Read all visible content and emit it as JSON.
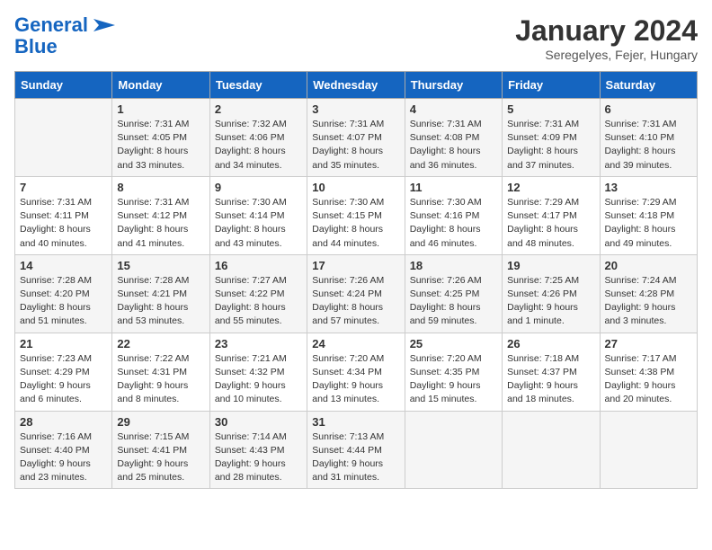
{
  "logo": {
    "line1": "General",
    "line2": "Blue"
  },
  "title": "January 2024",
  "subtitle": "Seregelyes, Fejer, Hungary",
  "days_of_week": [
    "Sunday",
    "Monday",
    "Tuesday",
    "Wednesday",
    "Thursday",
    "Friday",
    "Saturday"
  ],
  "weeks": [
    [
      {
        "day": "",
        "sunrise": "",
        "sunset": "",
        "daylight": ""
      },
      {
        "day": "1",
        "sunrise": "Sunrise: 7:31 AM",
        "sunset": "Sunset: 4:05 PM",
        "daylight": "Daylight: 8 hours and 33 minutes."
      },
      {
        "day": "2",
        "sunrise": "Sunrise: 7:32 AM",
        "sunset": "Sunset: 4:06 PM",
        "daylight": "Daylight: 8 hours and 34 minutes."
      },
      {
        "day": "3",
        "sunrise": "Sunrise: 7:31 AM",
        "sunset": "Sunset: 4:07 PM",
        "daylight": "Daylight: 8 hours and 35 minutes."
      },
      {
        "day": "4",
        "sunrise": "Sunrise: 7:31 AM",
        "sunset": "Sunset: 4:08 PM",
        "daylight": "Daylight: 8 hours and 36 minutes."
      },
      {
        "day": "5",
        "sunrise": "Sunrise: 7:31 AM",
        "sunset": "Sunset: 4:09 PM",
        "daylight": "Daylight: 8 hours and 37 minutes."
      },
      {
        "day": "6",
        "sunrise": "Sunrise: 7:31 AM",
        "sunset": "Sunset: 4:10 PM",
        "daylight": "Daylight: 8 hours and 39 minutes."
      }
    ],
    [
      {
        "day": "7",
        "sunrise": "Sunrise: 7:31 AM",
        "sunset": "Sunset: 4:11 PM",
        "daylight": "Daylight: 8 hours and 40 minutes."
      },
      {
        "day": "8",
        "sunrise": "Sunrise: 7:31 AM",
        "sunset": "Sunset: 4:12 PM",
        "daylight": "Daylight: 8 hours and 41 minutes."
      },
      {
        "day": "9",
        "sunrise": "Sunrise: 7:30 AM",
        "sunset": "Sunset: 4:14 PM",
        "daylight": "Daylight: 8 hours and 43 minutes."
      },
      {
        "day": "10",
        "sunrise": "Sunrise: 7:30 AM",
        "sunset": "Sunset: 4:15 PM",
        "daylight": "Daylight: 8 hours and 44 minutes."
      },
      {
        "day": "11",
        "sunrise": "Sunrise: 7:30 AM",
        "sunset": "Sunset: 4:16 PM",
        "daylight": "Daylight: 8 hours and 46 minutes."
      },
      {
        "day": "12",
        "sunrise": "Sunrise: 7:29 AM",
        "sunset": "Sunset: 4:17 PM",
        "daylight": "Daylight: 8 hours and 48 minutes."
      },
      {
        "day": "13",
        "sunrise": "Sunrise: 7:29 AM",
        "sunset": "Sunset: 4:18 PM",
        "daylight": "Daylight: 8 hours and 49 minutes."
      }
    ],
    [
      {
        "day": "14",
        "sunrise": "Sunrise: 7:28 AM",
        "sunset": "Sunset: 4:20 PM",
        "daylight": "Daylight: 8 hours and 51 minutes."
      },
      {
        "day": "15",
        "sunrise": "Sunrise: 7:28 AM",
        "sunset": "Sunset: 4:21 PM",
        "daylight": "Daylight: 8 hours and 53 minutes."
      },
      {
        "day": "16",
        "sunrise": "Sunrise: 7:27 AM",
        "sunset": "Sunset: 4:22 PM",
        "daylight": "Daylight: 8 hours and 55 minutes."
      },
      {
        "day": "17",
        "sunrise": "Sunrise: 7:26 AM",
        "sunset": "Sunset: 4:24 PM",
        "daylight": "Daylight: 8 hours and 57 minutes."
      },
      {
        "day": "18",
        "sunrise": "Sunrise: 7:26 AM",
        "sunset": "Sunset: 4:25 PM",
        "daylight": "Daylight: 8 hours and 59 minutes."
      },
      {
        "day": "19",
        "sunrise": "Sunrise: 7:25 AM",
        "sunset": "Sunset: 4:26 PM",
        "daylight": "Daylight: 9 hours and 1 minute."
      },
      {
        "day": "20",
        "sunrise": "Sunrise: 7:24 AM",
        "sunset": "Sunset: 4:28 PM",
        "daylight": "Daylight: 9 hours and 3 minutes."
      }
    ],
    [
      {
        "day": "21",
        "sunrise": "Sunrise: 7:23 AM",
        "sunset": "Sunset: 4:29 PM",
        "daylight": "Daylight: 9 hours and 6 minutes."
      },
      {
        "day": "22",
        "sunrise": "Sunrise: 7:22 AM",
        "sunset": "Sunset: 4:31 PM",
        "daylight": "Daylight: 9 hours and 8 minutes."
      },
      {
        "day": "23",
        "sunrise": "Sunrise: 7:21 AM",
        "sunset": "Sunset: 4:32 PM",
        "daylight": "Daylight: 9 hours and 10 minutes."
      },
      {
        "day": "24",
        "sunrise": "Sunrise: 7:20 AM",
        "sunset": "Sunset: 4:34 PM",
        "daylight": "Daylight: 9 hours and 13 minutes."
      },
      {
        "day": "25",
        "sunrise": "Sunrise: 7:20 AM",
        "sunset": "Sunset: 4:35 PM",
        "daylight": "Daylight: 9 hours and 15 minutes."
      },
      {
        "day": "26",
        "sunrise": "Sunrise: 7:18 AM",
        "sunset": "Sunset: 4:37 PM",
        "daylight": "Daylight: 9 hours and 18 minutes."
      },
      {
        "day": "27",
        "sunrise": "Sunrise: 7:17 AM",
        "sunset": "Sunset: 4:38 PM",
        "daylight": "Daylight: 9 hours and 20 minutes."
      }
    ],
    [
      {
        "day": "28",
        "sunrise": "Sunrise: 7:16 AM",
        "sunset": "Sunset: 4:40 PM",
        "daylight": "Daylight: 9 hours and 23 minutes."
      },
      {
        "day": "29",
        "sunrise": "Sunrise: 7:15 AM",
        "sunset": "Sunset: 4:41 PM",
        "daylight": "Daylight: 9 hours and 25 minutes."
      },
      {
        "day": "30",
        "sunrise": "Sunrise: 7:14 AM",
        "sunset": "Sunset: 4:43 PM",
        "daylight": "Daylight: 9 hours and 28 minutes."
      },
      {
        "day": "31",
        "sunrise": "Sunrise: 7:13 AM",
        "sunset": "Sunset: 4:44 PM",
        "daylight": "Daylight: 9 hours and 31 minutes."
      },
      {
        "day": "",
        "sunrise": "",
        "sunset": "",
        "daylight": ""
      },
      {
        "day": "",
        "sunrise": "",
        "sunset": "",
        "daylight": ""
      },
      {
        "day": "",
        "sunrise": "",
        "sunset": "",
        "daylight": ""
      }
    ]
  ]
}
